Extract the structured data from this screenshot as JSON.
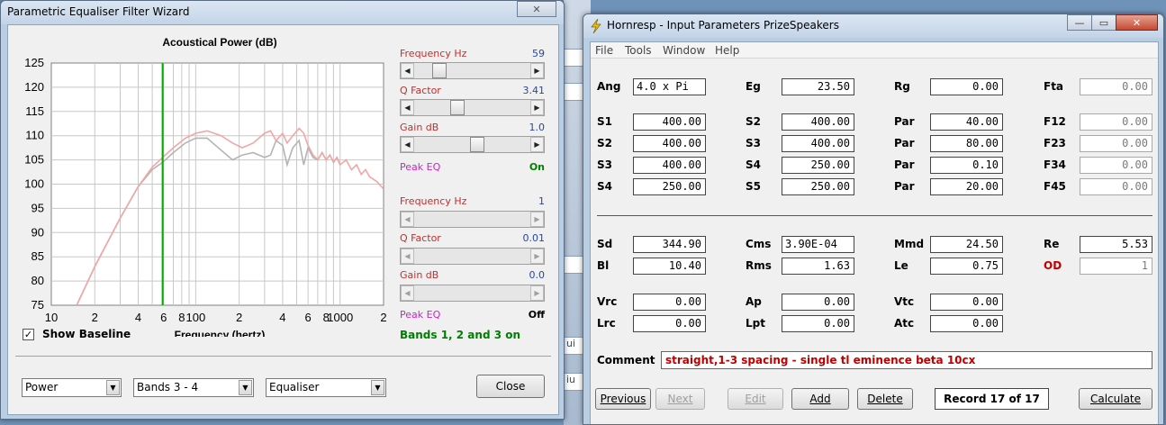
{
  "eq_window": {
    "title": "Parametric Equaliser Filter Wizard",
    "close_glyph": "✕",
    "show_baseline": {
      "label": "Show Baseline",
      "checked": true,
      "mark": "✓"
    },
    "band_a": {
      "frequency": {
        "label": "Frequency Hz",
        "value": "59",
        "position": 0.18
      },
      "q_factor": {
        "label": "Q Factor",
        "value": "3.41",
        "position": 0.35
      },
      "gain": {
        "label": "Gain dB",
        "value": "1.0",
        "position": 0.55
      },
      "peak": {
        "label": "Peak EQ",
        "value": "On",
        "color": "#008000"
      }
    },
    "band_b": {
      "frequency": {
        "label": "Frequency Hz",
        "value": "1"
      },
      "q_factor": {
        "label": "Q Factor",
        "value": "0.01"
      },
      "gain": {
        "label": "Gain dB",
        "value": "0.0"
      },
      "peak": {
        "label": "Peak EQ",
        "value": "Off",
        "color": "#000000"
      }
    },
    "bands_status": "Bands 1, 2 and 3 on",
    "combo_type": "Power",
    "combo_bands": "Bands 3 - 4",
    "combo_mode": "Equaliser",
    "close_button": "Close",
    "dropdown_glyph": "▼",
    "arrow_left": "◀",
    "arrow_right": "▶"
  },
  "chart_data": {
    "type": "line",
    "title": "Acoustical Power (dB)",
    "xlabel": "Frequency (hertz)",
    "ylabel": "",
    "xscale": "log",
    "xlim": [
      10,
      2000
    ],
    "ylim": [
      75,
      125
    ],
    "yticks": [
      "125",
      "120",
      "115",
      "110",
      "105",
      "100",
      "95",
      "90",
      "85",
      "80",
      "75"
    ],
    "xticks": [
      {
        "v": 10,
        "t": "10"
      },
      {
        "v": 20,
        "t": "2"
      },
      {
        "v": 40,
        "t": "4"
      },
      {
        "v": 60,
        "t": "6"
      },
      {
        "v": 80,
        "t": "8"
      },
      {
        "v": 100,
        "t": "100"
      },
      {
        "v": 200,
        "t": "2"
      },
      {
        "v": 400,
        "t": "4"
      },
      {
        "v": 600,
        "t": "6"
      },
      {
        "v": 800,
        "t": "8"
      },
      {
        "v": 1000,
        "t": "1000"
      },
      {
        "v": 2000,
        "t": "2"
      }
    ],
    "marker_frequency": 59,
    "grid": true,
    "series": [
      {
        "color": "#f2a6a6",
        "x": [
          15,
          20,
          30,
          40,
          50,
          59,
          70,
          85,
          100,
          120,
          150,
          180,
          210,
          250,
          300,
          330,
          360,
          400,
          430,
          470,
          520,
          560,
          600,
          650,
          700,
          750,
          800,
          850,
          900,
          950,
          1000,
          1100,
          1200,
          1300,
          1400,
          1500,
          1600,
          1700,
          1800,
          2000
        ],
        "y": [
          75,
          83,
          93,
          99.5,
          103.5,
          105.5,
          107.5,
          109.5,
          110.5,
          111,
          110,
          108.5,
          107.5,
          108.5,
          110.5,
          111,
          109,
          110.5,
          108.5,
          110,
          111.5,
          110.5,
          108,
          106,
          105,
          106.5,
          105,
          106,
          104.5,
          105.5,
          104,
          105,
          103,
          104,
          102,
          103,
          101.5,
          101,
          100.5,
          99
        ]
      },
      {
        "color": "#b4b4b4",
        "x": [
          15,
          20,
          30,
          40,
          50,
          59,
          70,
          85,
          100,
          120,
          150,
          180,
          210,
          250,
          300,
          330,
          360,
          400,
          430,
          470,
          520,
          560,
          600,
          650,
          700,
          750,
          800,
          850,
          900,
          950,
          1000
        ],
        "y": [
          75,
          83,
          93,
          99.5,
          103,
          104.5,
          106.5,
          108.5,
          109.5,
          109.5,
          107,
          105,
          106,
          106.5,
          105.5,
          106,
          109,
          108,
          104,
          107.5,
          109,
          104,
          107.5,
          105.5,
          105,
          106.5,
          105,
          106,
          104.5,
          105.5,
          104
        ]
      }
    ]
  },
  "hornresp": {
    "title": "Hornresp - Input Parameters  PrizeSpeakers",
    "window_buttons": {
      "minimize": "—",
      "restore": "▭",
      "close": "✕"
    },
    "menu": [
      "File",
      "Tools",
      "Window",
      "Help"
    ],
    "rows": [
      [
        {
          "l": "Ang",
          "v": "4.0 x Pi"
        },
        {
          "l": "Eg",
          "v": "23.50"
        },
        {
          "l": "Rg",
          "v": "0.00"
        },
        {
          "l": "Fta",
          "v": "0.00"
        }
      ],
      [
        {
          "l": "S1",
          "v": "400.00"
        },
        {
          "l": "S2",
          "v": "400.00"
        },
        {
          "l": "Par",
          "v": "40.00"
        },
        {
          "l": "F12",
          "v": "0.00"
        }
      ],
      [
        {
          "l": "S2",
          "v": "400.00"
        },
        {
          "l": "S3",
          "v": "400.00"
        },
        {
          "l": "Par",
          "v": "80.00"
        },
        {
          "l": "F23",
          "v": "0.00"
        }
      ],
      [
        {
          "l": "S3",
          "v": "400.00"
        },
        {
          "l": "S4",
          "v": "250.00"
        },
        {
          "l": "Par",
          "v": "0.10"
        },
        {
          "l": "F34",
          "v": "0.00"
        }
      ],
      [
        {
          "l": "S4",
          "v": "250.00"
        },
        {
          "l": "S5",
          "v": "250.00"
        },
        {
          "l": "Par",
          "v": "20.00"
        },
        {
          "l": "F45",
          "v": "0.00"
        }
      ],
      [
        {
          "l": "Sd",
          "v": "344.90"
        },
        {
          "l": "Cms",
          "v": "3.90E-04"
        },
        {
          "l": "Mmd",
          "v": "24.50"
        },
        {
          "l": "Re",
          "v": "5.53"
        }
      ],
      [
        {
          "l": "Bl",
          "v": "10.40"
        },
        {
          "l": "Rms",
          "v": "1.63"
        },
        {
          "l": "Le",
          "v": "0.75"
        },
        {
          "l": "OD",
          "v": "1"
        }
      ],
      [
        {
          "l": "Vrc",
          "v": "0.00"
        },
        {
          "l": "Ap",
          "v": "0.00"
        },
        {
          "l": "Vtc",
          "v": "0.00"
        }
      ],
      [
        {
          "l": "Lrc",
          "v": "0.00"
        },
        {
          "l": "Lpt",
          "v": "0.00"
        },
        {
          "l": "Atc",
          "v": "0.00"
        }
      ]
    ],
    "comment_label": "Comment",
    "comment_value": "straight,1-3 spacing - single tl eminence beta 10cx",
    "buttons": {
      "previous": "Previous",
      "next": "Next",
      "edit": "Edit",
      "add": "Add",
      "delete": "Delete",
      "calculate": "Calculate"
    },
    "record": "Record 17 of 17"
  },
  "background": {
    "fragments": [
      "ui",
      "iu"
    ]
  }
}
